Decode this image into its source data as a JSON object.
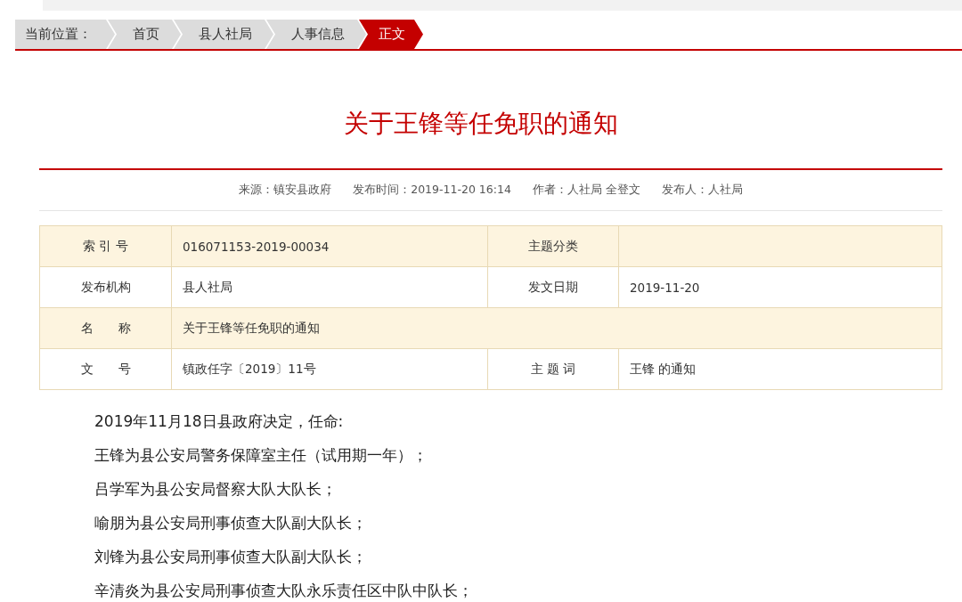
{
  "breadcrumb": {
    "label": "当前位置：",
    "items": [
      {
        "text": "首页",
        "selected": false
      },
      {
        "text": "县人社局",
        "selected": false
      },
      {
        "text": "人事信息",
        "selected": false
      },
      {
        "text": "正文",
        "selected": true
      }
    ]
  },
  "article": {
    "title": "关于王锋等任免职的通知",
    "meta": [
      "来源：镇安县政府",
      "发布时间：2019-11-20 16:14",
      "作者：人社局 全登文",
      "发布人：人社局"
    ],
    "info_table": [
      [
        {
          "text": "索 引 号",
          "kind": "label"
        },
        {
          "text": "016071153-2019-00034",
          "kind": "value"
        },
        {
          "text": "主题分类",
          "kind": "label"
        },
        {
          "kind": "value"
        }
      ],
      [
        {
          "text": "发布机构",
          "kind": "label"
        },
        {
          "text": "县人社局",
          "kind": "value"
        },
        {
          "text": "发文日期",
          "kind": "label"
        },
        {
          "text": "2019-11-20",
          "kind": "value"
        }
      ],
      [
        {
          "text": "名　　称",
          "kind": "label"
        },
        {
          "text": "关于王锋等任免职的通知",
          "kind": "wide"
        }
      ],
      [
        {
          "text": "文　　号",
          "kind": "label"
        },
        {
          "text": "镇政任字〔2019〕11号",
          "kind": "value"
        },
        {
          "text": "主 题 词",
          "kind": "label"
        },
        {
          "text": "王锋 的通知",
          "kind": "value"
        }
      ]
    ],
    "paragraphs": [
      "2019年11月18日县政府决定，任命:",
      "王锋为县公安局警务保障室主任（试用期一年）；",
      "吕学军为县公安局督察大队大队长；",
      "喻朋为县公安局刑事侦查大队副大队长；",
      "刘锋为县公安局刑事侦查大队副大队长；",
      "辛清炎为县公安局刑事侦查大队永乐责任区中队中队长；"
    ]
  }
}
